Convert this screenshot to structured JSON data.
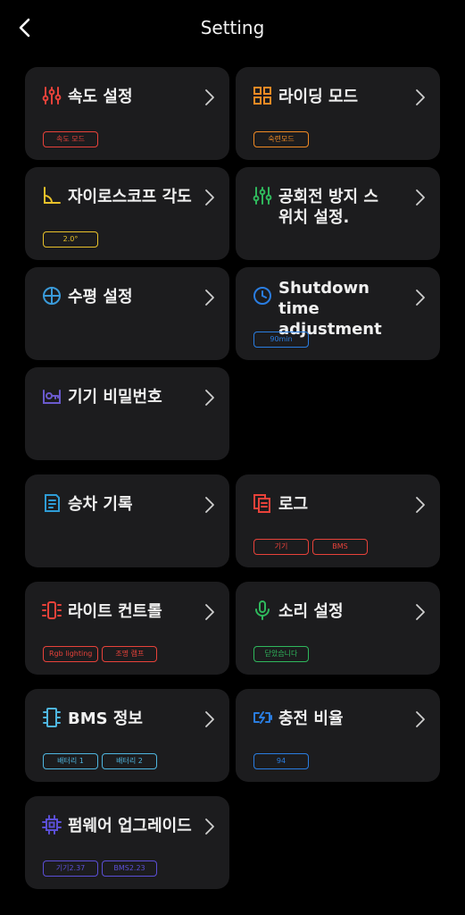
{
  "header": {
    "title": "Setting"
  },
  "cards": {
    "speed": {
      "label": "속도 설정",
      "tags": [
        "속도 모드"
      ],
      "color": "#e8423a"
    },
    "riding": {
      "label": "라이딩 모드",
      "tags": [
        "숙련모드"
      ],
      "color": "#f08a24"
    },
    "gyro": {
      "label": "자이로스코프 각도",
      "tags": [
        "2.0°"
      ],
      "color": "#e8c12a"
    },
    "idle": {
      "label": "공회전 방지 스위치 설정.",
      "tags": [],
      "color": "#2fb85c"
    },
    "level": {
      "label": "수평 설정",
      "tags": [],
      "color": "#3a9ad9"
    },
    "shutdown": {
      "label": "Shutdown time adjustment",
      "tags": [
        "90min"
      ],
      "color": "#2a7de1"
    },
    "password": {
      "label": "기기 비밀번호",
      "tags": [],
      "color": "#6a5acd"
    },
    "ride_log": {
      "label": "승차 기록",
      "tags": [],
      "color": "#2e9cd6"
    },
    "log": {
      "label": "로그",
      "tags": [
        "기기",
        "BMS"
      ],
      "color": "#e8423a"
    },
    "light": {
      "label": "라이트 컨트롤",
      "tags": [
        "Rgb lighting",
        "조명 램프"
      ],
      "color": "#e8423a"
    },
    "sound": {
      "label": "소리 설정",
      "tags": [
        "닫았습니다"
      ],
      "color": "#2fb85c"
    },
    "bms": {
      "label": "BMS 정보",
      "tags": [
        "배터리 1",
        "배터리 2"
      ],
      "color": "#4fb6e0"
    },
    "charge": {
      "label": "충전 비율",
      "tags": [
        "94"
      ],
      "color": "#2a7de1"
    },
    "firmware": {
      "label": "펌웨어 업그레이드",
      "tags": [
        "기기2.37",
        "BMS2.23"
      ],
      "color": "#5b4fd6"
    }
  }
}
